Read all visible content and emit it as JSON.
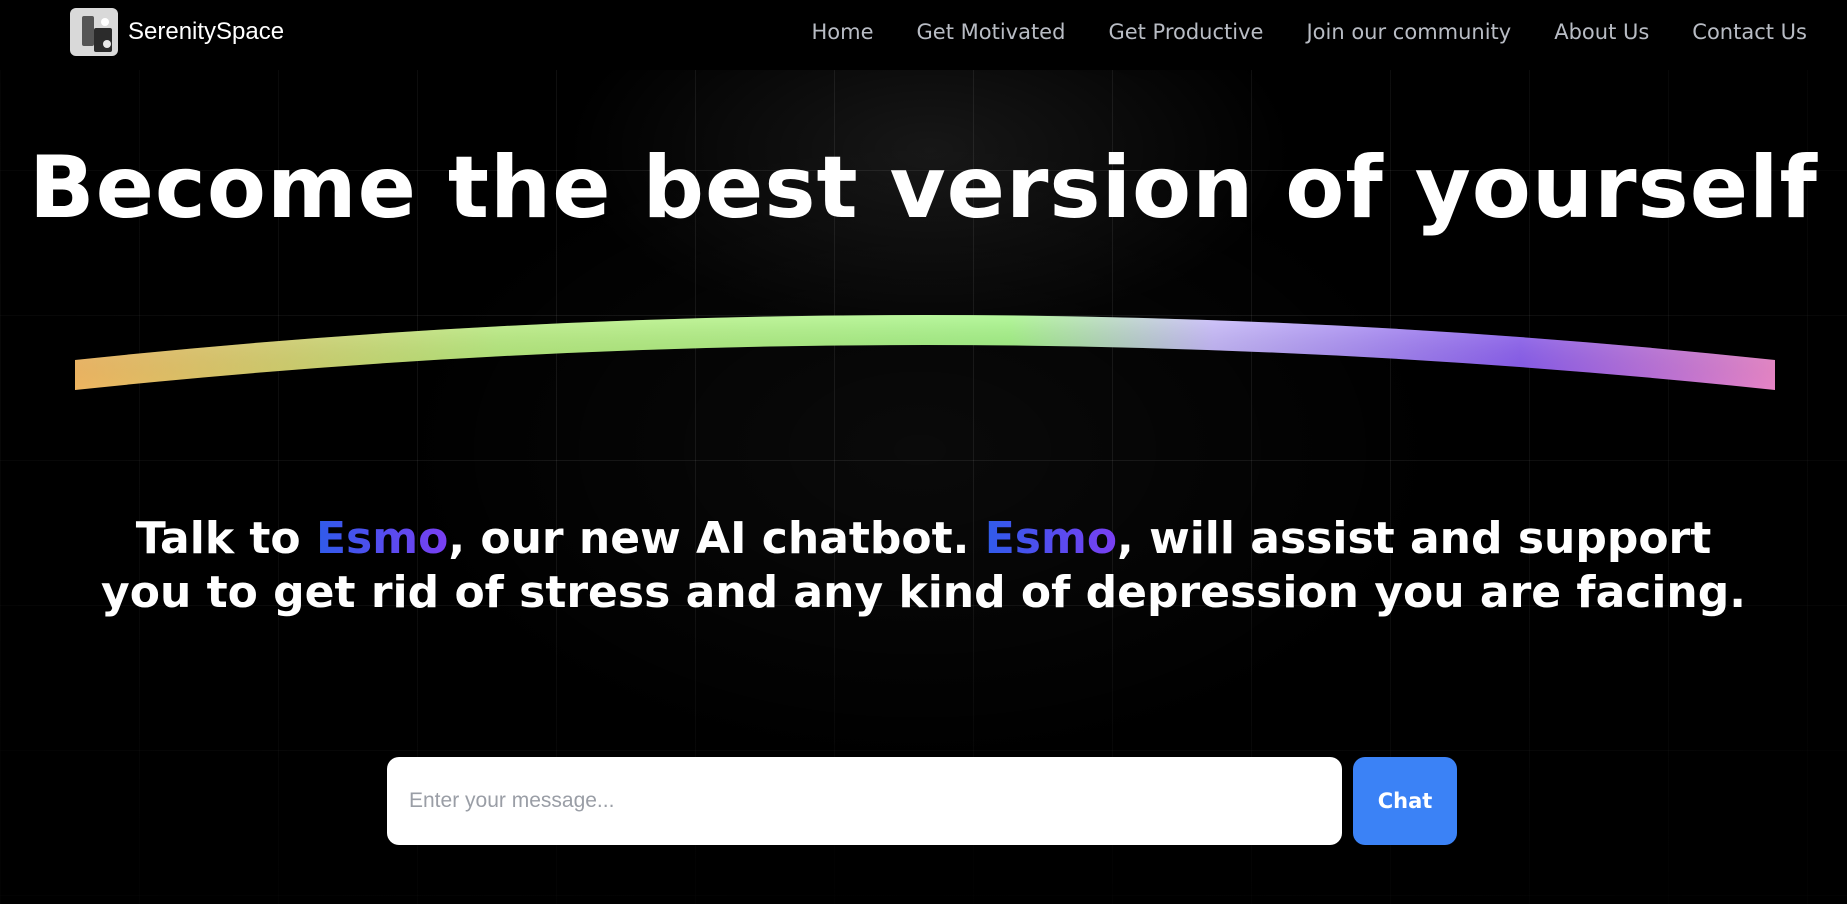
{
  "navbar": {
    "brand": "SerenitySpace",
    "links": [
      {
        "label": "Home"
      },
      {
        "label": "Get Motivated"
      },
      {
        "label": "Get Productive"
      },
      {
        "label": "Join our community"
      },
      {
        "label": "About Us"
      },
      {
        "label": "Contact Us"
      }
    ]
  },
  "hero": {
    "title": "Become the best version of yourself",
    "subtitle": {
      "part1": "Talk to ",
      "esmo1": "Esmo",
      "part2": ", our new AI chatbot. ",
      "esmo2": "Esmo",
      "part3": ", will assist and support you to get rid of stress and any kind of depression you are facing."
    }
  },
  "chat": {
    "placeholder": "Enter your message...",
    "value": "",
    "button_label": "Chat"
  },
  "colors": {
    "background": "#000000",
    "accent_button": "#3b82f6",
    "esmo_gradient_start": "#2f5bea",
    "esmo_gradient_end": "#7a3ff2",
    "arc_gradient": [
      "#fbbf66",
      "#b8f07a",
      "#9ef57d",
      "#8b5cf6",
      "#f38bd0"
    ]
  }
}
